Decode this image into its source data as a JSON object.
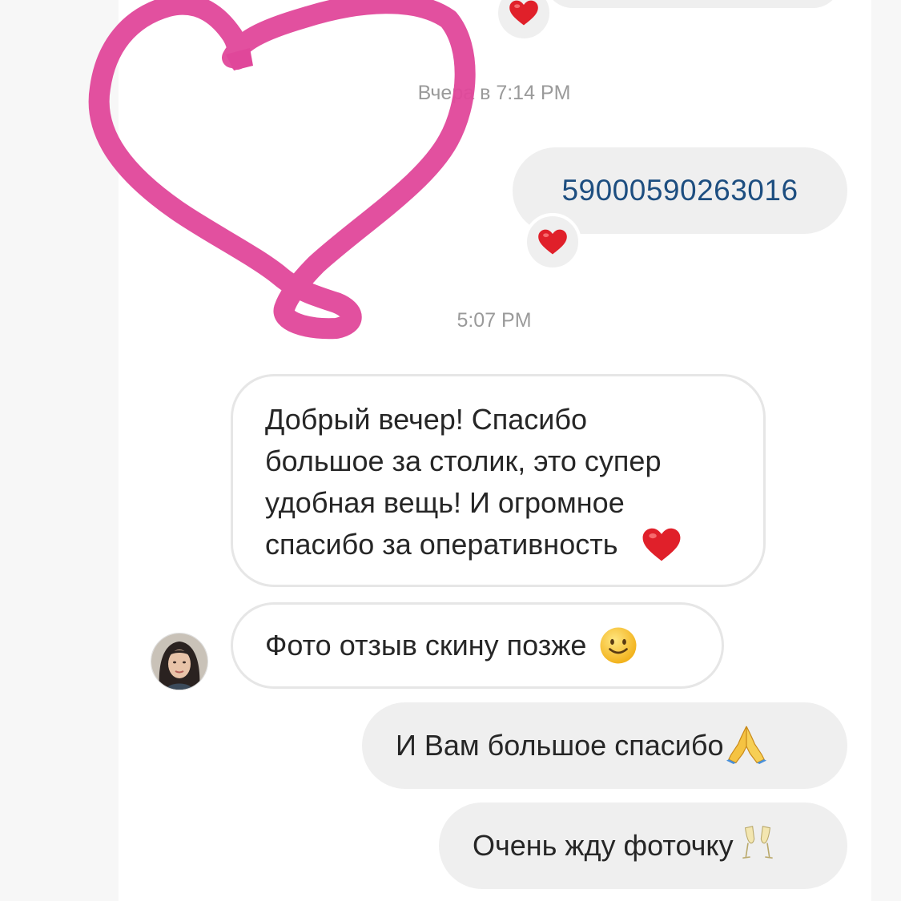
{
  "thread": {
    "top_partial_reaction": "heart",
    "timestamp_yesterday": "Вчера в 7:14 PM",
    "message_code": "59000590263016",
    "message_code_reaction": "heart",
    "timestamp_today": "5:07 PM",
    "incoming_message_1": {
      "lines": [
        "Добрый вечер! Спасибо",
        "большое за столик, это супер",
        "удобная вещь! И огромное",
        "спасибо за оперативность"
      ],
      "trailing_emoji": "red-heart"
    },
    "incoming_message_2": {
      "text": "Фото отзыв скину позже",
      "trailing_emoji": "slightly-smiling-face"
    },
    "outgoing_message_1": {
      "text": "И Вам большое спасибо",
      "trailing_emoji": "folded-hands"
    },
    "outgoing_message_2": {
      "text": "Очень жду фоточку",
      "trailing_emoji": "clinking-glasses"
    }
  },
  "colors": {
    "outgoing_bubble": "#efefef",
    "incoming_border": "#e6e6e6",
    "code_link": "#1d4e80",
    "timestamp": "#9a9a9a",
    "reaction_heart": "#e0202a",
    "hand_drawn_heart": "#e0479a"
  }
}
